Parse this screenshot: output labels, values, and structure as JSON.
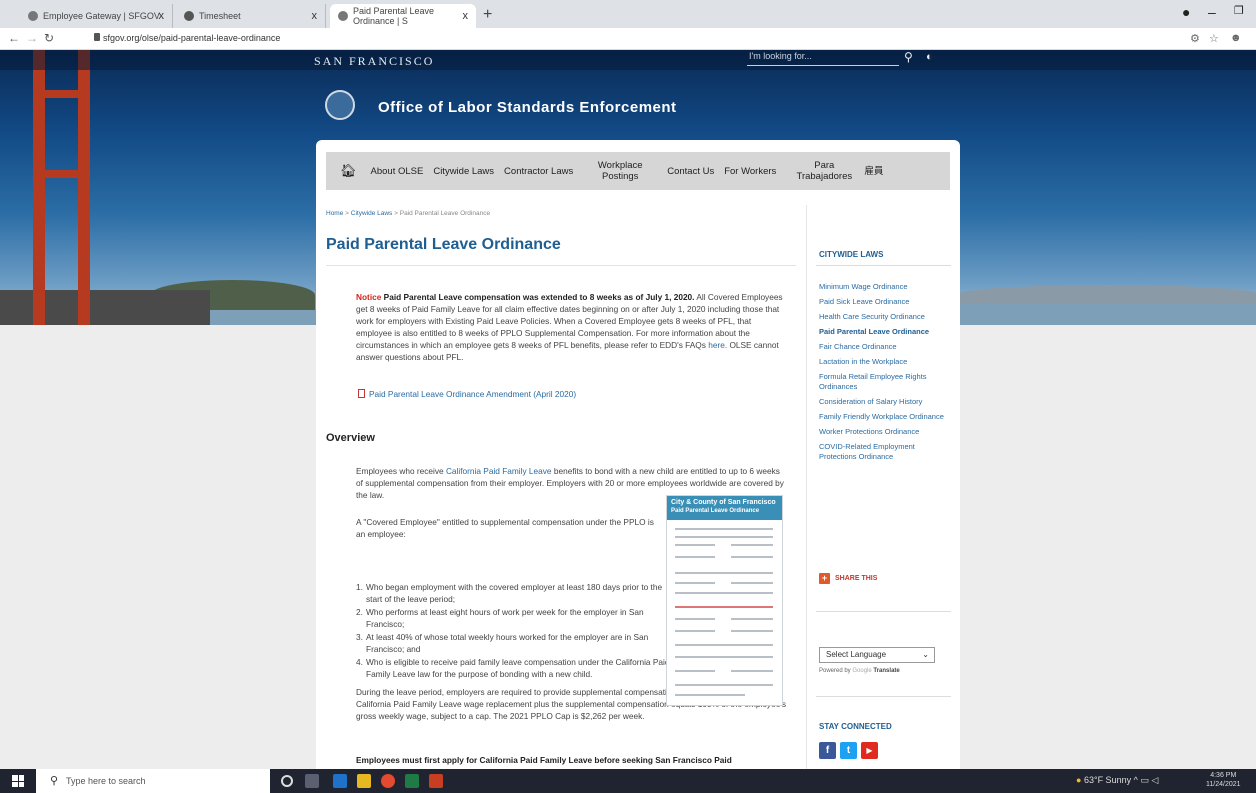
{
  "browser": {
    "tabs": [
      {
        "label": "Employee Gateway | SFGOV",
        "active": false
      },
      {
        "label": "Timesheet",
        "active": false
      },
      {
        "label": "Paid Parental Leave Ordinance | S",
        "active": true
      }
    ],
    "close_glyph": "x",
    "new_tab_glyph": "+",
    "address": "sfgov.org/olse/paid-parental-leave-ordinance"
  },
  "site": {
    "sf_label": "SAN FRANCISCO",
    "search_placeholder": "I'm looking for...",
    "title": "Office of Labor Standards Enforcement",
    "nav": [
      "About OLSE",
      "Citywide Laws",
      "Contractor Laws",
      "Workplace Postings",
      "Contact Us",
      "For Workers",
      "Para Trabajadores",
      "雇員"
    ]
  },
  "page": {
    "breadcrumb": {
      "home": "Home",
      "sep": ">",
      "citywide": "Citywide Laws",
      "current": "Paid Parental Leave Ordinance"
    },
    "title": "Paid Parental Leave Ordinance",
    "notice_label": "Notice",
    "notice_bold": "Paid Parental Leave compensation was extended to 8 weeks as of July 1, 2020.",
    "notice_body": "All Covered Employees get 8 weeks of Paid Family Leave for all claim effective dates beginning on or after July 1, 2020 including those that work for employers with Existing Paid Leave Policies. When a Covered Employee gets 8 weeks of PFL, that employee is also entitled to 8 weeks of PPLO Supplemental Compensation. For more information about the circumstances in which an employee gets 8 weeks of PFL benefits, please refer to EDD's FAQs",
    "notice_link": "here",
    "notice_tail": ". OLSE cannot answer questions about PFL.",
    "amendment_link": "Paid Parental Leave Ordinance Amendment (April 2020)",
    "overview_heading": "Overview",
    "overview_p1_a": "Employees who receive",
    "overview_p1_link": "California Paid Family Leave",
    "overview_p1_b": "benefits to bond with a new child are entitled to up to 6 weeks of supplemental compensation from their employer.  Employers with 20 or more employees worldwide are covered by the law.",
    "covered_intro": "A \"Covered Employee\" entitled to supplemental compensation under the PPLO is an employee:",
    "criteria": [
      {
        "num": "1.",
        "text": "Who began employment with the covered employer at least 180 days prior to the start of the leave period;"
      },
      {
        "num": "2.",
        "text": "Who performs at least eight hours of work per week for the employer in San Francisco;"
      },
      {
        "num": "3.",
        "text": "At least 40% of whose total weekly hours worked for the employer are in San Francisco; and"
      },
      {
        "num": "4.",
        "text": "Who is eligible to receive paid family leave compensation under the California Paid Family Leave law for the purpose of bonding with a new child."
      }
    ],
    "leave_period_p": "During the leave period, employers are required to provide supplemental compensation in an amount such that the California Paid Family Leave wage replacement plus the supplemental compensation equals 100% of the employee's gross weekly wage, subject to a cap. The 2021 PPLO Cap is $2,262 per week.",
    "bottom_bold": "Employees must first apply for California Paid Family Leave before seeking San Francisco Paid",
    "poster_title_1": "City & County of San Francisco",
    "poster_title_2": "Paid Parental Leave Ordinance"
  },
  "sidebar": {
    "heading": "CITYWIDE LAWS",
    "items": [
      {
        "label": "Minimum Wage Ordinance",
        "current": false
      },
      {
        "label": "Paid Sick Leave Ordinance",
        "current": false
      },
      {
        "label": "Health Care Security Ordinance",
        "current": false
      },
      {
        "label": "Paid Parental Leave Ordinance",
        "current": true
      },
      {
        "label": "Fair Chance Ordinance",
        "current": false
      },
      {
        "label": "Lactation in the Workplace",
        "current": false
      },
      {
        "label": "Formula Retail Employee Rights Ordinances",
        "current": false
      },
      {
        "label": "Consideration of Salary History",
        "current": false
      },
      {
        "label": "Family Friendly Workplace Ordinance",
        "current": false
      },
      {
        "label": "Worker Protections Ordinance",
        "current": false
      },
      {
        "label": "COVID-Related Employment Protections Ordinance",
        "current": false
      }
    ],
    "share_label": "SHARE THIS",
    "language_select": "Select Language",
    "powered_by": "Powered by",
    "google": "Google",
    "translate": "Translate",
    "stay_connected": "STAY CONNECTED",
    "social": [
      {
        "name": "facebook",
        "glyph": "f",
        "color": "#3b5998"
      },
      {
        "name": "twitter",
        "glyph": "t",
        "color": "#1da1f2"
      },
      {
        "name": "youtube",
        "glyph": "▶",
        "color": "#e02a20"
      }
    ]
  },
  "taskbar": {
    "search_placeholder": "Type here to search",
    "weather": "63°F  Sunny",
    "time": "4:36 PM",
    "date": "11/24/2021"
  }
}
